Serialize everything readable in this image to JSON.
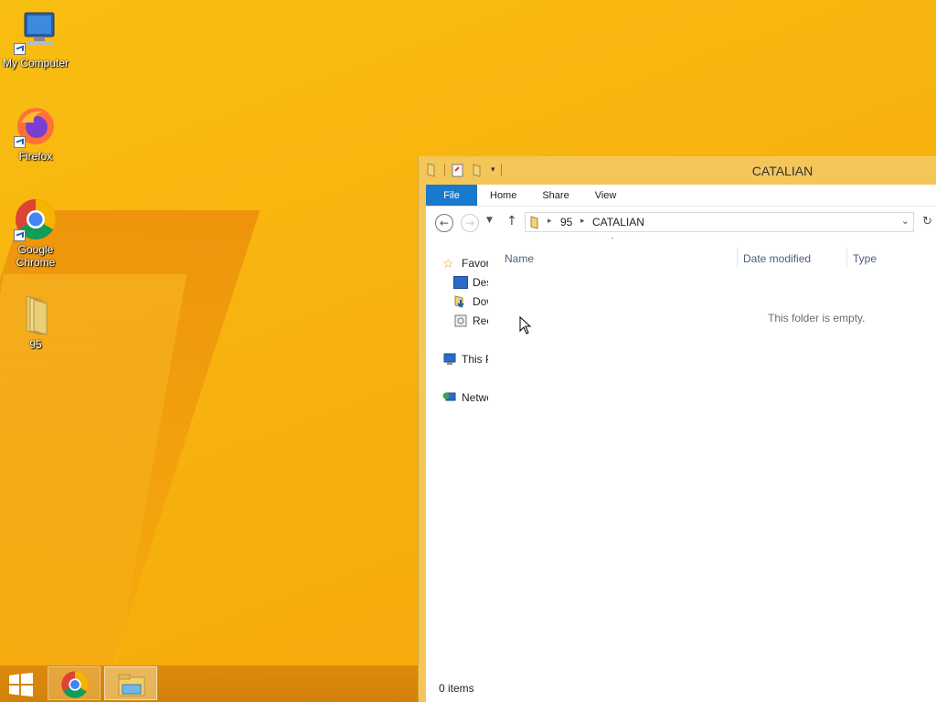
{
  "desktop": {
    "icons": [
      {
        "label": "My Computer"
      },
      {
        "label": "Firefox"
      },
      {
        "label": "Google Chrome"
      },
      {
        "label": "95"
      }
    ]
  },
  "window": {
    "title": "CATALIAN",
    "ribbon_tabs": [
      "File",
      "Home",
      "Share",
      "View"
    ],
    "address": {
      "segments": [
        "95",
        "CATALIAN"
      ]
    },
    "nav": {
      "favorites": "Favorites",
      "desktop": "Desktop",
      "downloads": "Downloads",
      "recent": "Recent places",
      "this_pc": "This PC",
      "network": "Network"
    },
    "columns": [
      "Name",
      "Date modified",
      "Type"
    ],
    "empty_text": "This folder is empty.",
    "status": "0 items"
  },
  "colors": {
    "accent": "#1979ca",
    "wallpaper": "#f7b10c",
    "titlebar": "#f4c65a"
  }
}
